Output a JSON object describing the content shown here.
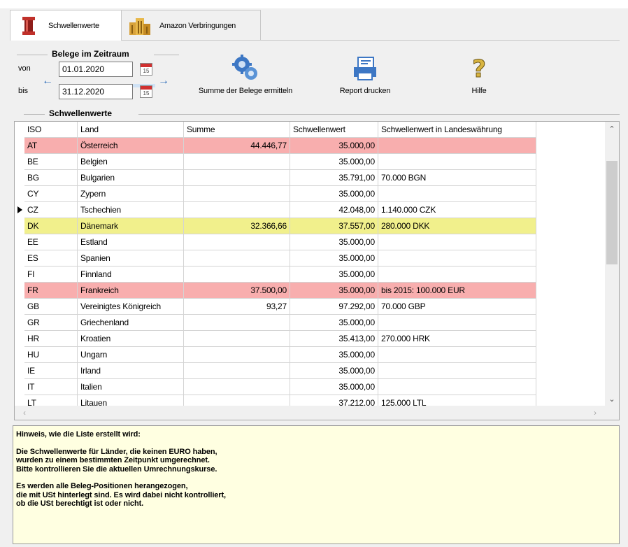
{
  "tabs": [
    {
      "label": "Schwellenwerte",
      "icon": "threshold-bracket-icon",
      "active": true
    },
    {
      "label": "Amazon Verbringungen",
      "icon": "warehouse-icon",
      "active": false
    }
  ],
  "period": {
    "title": "Belege im Zeitraum",
    "from_label": "von",
    "from_value": "01.01.2020",
    "to_label": "bis",
    "to_value": "31.12.2020",
    "calendar_glyph": "15"
  },
  "toolbar": {
    "calc_label": "Summe der Belege ermitteln",
    "report_label": "Report drucken",
    "help_label": "Hilfe"
  },
  "section": {
    "title": "Schwellenwerte"
  },
  "table": {
    "columns": [
      "ISO",
      "Land",
      "Summe",
      "Schwellenwert",
      "Schwellenwert in Landeswährung"
    ],
    "rows": [
      {
        "iso": "AT",
        "land": "Österreich",
        "summe": "44.446,77",
        "schwelle": "35.000,00",
        "landeswaehrung": "",
        "highlight": "red"
      },
      {
        "iso": "BE",
        "land": "Belgien",
        "summe": "",
        "schwelle": "35.000,00",
        "landeswaehrung": "",
        "highlight": ""
      },
      {
        "iso": "BG",
        "land": "Bulgarien",
        "summe": "",
        "schwelle": "35.791,00",
        "landeswaehrung": "70.000 BGN",
        "highlight": ""
      },
      {
        "iso": "CY",
        "land": "Zypern",
        "summe": "",
        "schwelle": "35.000,00",
        "landeswaehrung": "",
        "highlight": ""
      },
      {
        "iso": "CZ",
        "land": "Tschechien",
        "summe": "",
        "schwelle": "42.048,00",
        "landeswaehrung": "1.140.000 CZK",
        "highlight": "",
        "current": true
      },
      {
        "iso": "DK",
        "land": "Dänemark",
        "summe": "32.366,66",
        "schwelle": "37.557,00",
        "landeswaehrung": "280.000 DKK",
        "highlight": "yellow"
      },
      {
        "iso": "EE",
        "land": "Estland",
        "summe": "",
        "schwelle": "35.000,00",
        "landeswaehrung": "",
        "highlight": ""
      },
      {
        "iso": "ES",
        "land": "Spanien",
        "summe": "",
        "schwelle": "35.000,00",
        "landeswaehrung": "",
        "highlight": ""
      },
      {
        "iso": "FI",
        "land": "Finnland",
        "summe": "",
        "schwelle": "35.000,00",
        "landeswaehrung": "",
        "highlight": ""
      },
      {
        "iso": "FR",
        "land": "Frankreich",
        "summe": "37.500,00",
        "schwelle": "35.000,00",
        "landeswaehrung": "bis 2015: 100.000 EUR",
        "highlight": "red"
      },
      {
        "iso": "GB",
        "land": "Vereinigtes Königreich",
        "summe": "93,27",
        "schwelle": "97.292,00",
        "landeswaehrung": "70.000 GBP",
        "highlight": ""
      },
      {
        "iso": "GR",
        "land": "Griechenland",
        "summe": "",
        "schwelle": "35.000,00",
        "landeswaehrung": "",
        "highlight": ""
      },
      {
        "iso": "HR",
        "land": "Kroatien",
        "summe": "",
        "schwelle": "35.413,00",
        "landeswaehrung": "270.000 HRK",
        "highlight": ""
      },
      {
        "iso": "HU",
        "land": "Ungarn",
        "summe": "",
        "schwelle": "35.000,00",
        "landeswaehrung": "",
        "highlight": ""
      },
      {
        "iso": "IE",
        "land": "Irland",
        "summe": "",
        "schwelle": "35.000,00",
        "landeswaehrung": "",
        "highlight": ""
      },
      {
        "iso": "IT",
        "land": "Italien",
        "summe": "",
        "schwelle": "35.000,00",
        "landeswaehrung": "",
        "highlight": ""
      },
      {
        "iso": "LT",
        "land": "Litauen",
        "summe": "",
        "schwelle": "37.212,00",
        "landeswaehrung": "125.000 LTL",
        "highlight": ""
      }
    ]
  },
  "hint": {
    "heading": "Hinweis, wie die Liste erstellt wird:",
    "p1": [
      "Die Schwellenwerte für Länder, die keinen EURO haben,",
      "wurden zu einem bestimmten Zeitpunkt umgerechnet.",
      "Bitte kontrollieren Sie die aktuellen Umrechnungskurse."
    ],
    "p2": [
      "Es werden alle Beleg-Positionen herangezogen,",
      "die mit USt hinterlegt sind. Es wird dabei nicht kontrolliert,",
      "ob die USt berechtigt ist oder nicht."
    ]
  },
  "colors": {
    "row_red": "#f8aeae",
    "row_yellow": "#f1f08c",
    "hint_bg": "#ffffe1",
    "arrow_blue": "#2a6ab8"
  }
}
